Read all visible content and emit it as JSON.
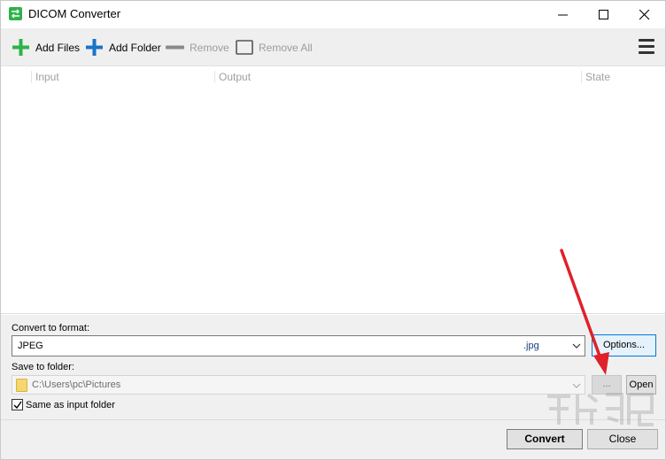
{
  "window": {
    "title": "DICOM Converter"
  },
  "toolbar": {
    "add_files": "Add Files",
    "add_folder": "Add Folder",
    "remove": "Remove",
    "remove_all": "Remove All",
    "menu_icon": "hamburger-menu-icon"
  },
  "list": {
    "columns": [
      "Input",
      "Output",
      "State"
    ],
    "rows": []
  },
  "format": {
    "label": "Convert to format:",
    "value": "JPEG",
    "extension": ".jpg",
    "options_button": "Options..."
  },
  "folder": {
    "label": "Save to folder:",
    "path": "C:\\Users\\pc\\Pictures",
    "browse_button": "...",
    "open_button": "Open",
    "same_as_input_label": "Same as input folder",
    "same_as_input_checked": true
  },
  "footer": {
    "convert": "Convert",
    "close": "Close"
  },
  "colors": {
    "accent_green": "#2db34a",
    "accent_blue": "#1a73c8",
    "annotation_arrow": "#e0202a"
  }
}
